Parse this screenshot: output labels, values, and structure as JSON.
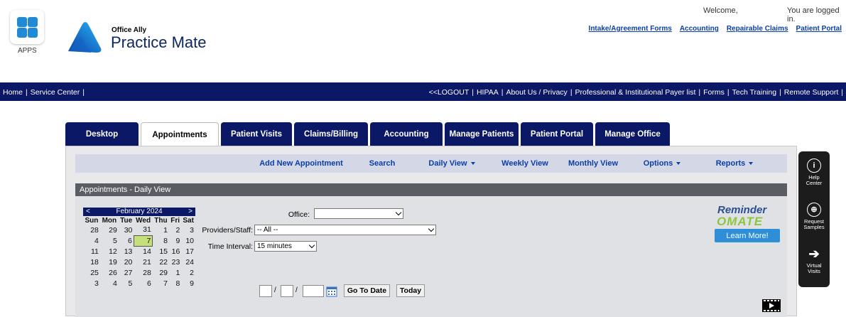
{
  "header": {
    "apps_label": "APPS",
    "brand_small": "Office Ally",
    "brand_big": "Practice Mate",
    "welcome": "Welcome,",
    "logged_in": "You are logged in.",
    "top_links": [
      "Intake/Agreement Forms",
      "Accounting",
      "Repairable Claims",
      "Patient Portal"
    ]
  },
  "navbar": {
    "left": [
      "Home",
      "Service Center"
    ],
    "right": [
      "<<LOGOUT",
      "HIPAA",
      "About Us / Privacy",
      "Professional & Institutional Payer list",
      "Forms",
      "Tech Training",
      "Remote Support"
    ]
  },
  "tabs": [
    "Desktop",
    "Appointments",
    "Patient Visits",
    "Claims/Billing",
    "Accounting",
    "Manage Patients",
    "Patient Portal",
    "Manage Office"
  ],
  "subbar": [
    "Add New Appointment",
    "Search",
    "Daily View",
    "Weekly View",
    "Monthly View",
    "Options",
    "Reports"
  ],
  "section_title": "Appointments - Daily View",
  "calendar": {
    "prev": "<",
    "next": ">",
    "month": "February 2024",
    "days": [
      "Sun",
      "Mon",
      "Tue",
      "Wed",
      "Thu",
      "Fri",
      "Sat"
    ],
    "weeks": [
      [
        "28",
        "29",
        "30",
        "31",
        "1",
        "2",
        "3"
      ],
      [
        "4",
        "5",
        "6",
        "7",
        "8",
        "9",
        "10"
      ],
      [
        "11",
        "12",
        "13",
        "14",
        "15",
        "16",
        "17"
      ],
      [
        "18",
        "19",
        "20",
        "21",
        "22",
        "23",
        "24"
      ],
      [
        "25",
        "26",
        "27",
        "28",
        "29",
        "1",
        "2"
      ],
      [
        "3",
        "4",
        "5",
        "6",
        "7",
        "8",
        "9"
      ]
    ],
    "today": "7"
  },
  "form": {
    "office_label": "Office:",
    "office_value": "",
    "providers_label": "Providers/Staff:",
    "providers_value": "-- All --",
    "interval_label": "Time Interval:",
    "interval_value": "15 minutes",
    "date_sep": "/",
    "go_to_date": "Go To Date",
    "today": "Today"
  },
  "reminder": {
    "line1": "Reminder",
    "line2": "OMATE",
    "learn_more": "Learn More!"
  },
  "side_panel": [
    {
      "icon": "i",
      "label": "Help\nCenter"
    },
    {
      "icon": "⊕",
      "label": "Request\nSamples"
    },
    {
      "icon": "➔",
      "label": "Virtual\nVisits"
    }
  ],
  "colors": {
    "nav_bg": "#0b1865",
    "link": "#0a3ea8",
    "today_highlight": "#c5e07b",
    "learn_button": "#2e8fd8"
  }
}
